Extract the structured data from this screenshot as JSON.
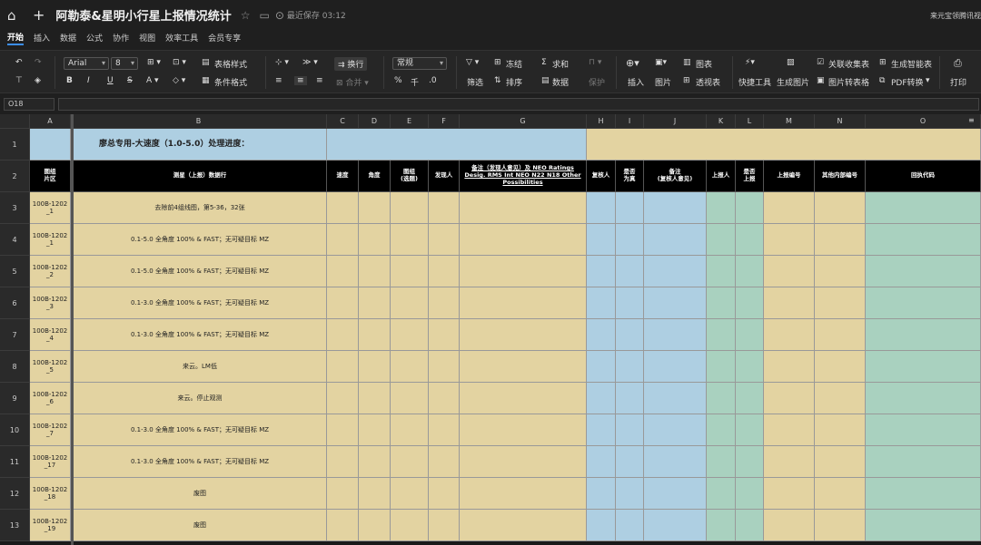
{
  "titlebar": {
    "title": "阿勒泰&星明小行星上报情况统计",
    "saved": "最近保存 03:12",
    "user": "来元宝领腾讯视频"
  },
  "menu": [
    "开始",
    "插入",
    "数据",
    "公式",
    "协作",
    "视图",
    "效率工具",
    "会员专享"
  ],
  "toolbar": {
    "font": "Arial",
    "size": "8",
    "table_style": "表格样式",
    "cond_format": "条件格式",
    "wrap": "换行",
    "merge": "合并",
    "number_format": "常规",
    "filter": "筛选",
    "freeze": "冻结",
    "sort": "排序",
    "sum": "求和",
    "data": "数据",
    "protect": "保护",
    "insert": "插入",
    "image": "图片",
    "chart": "图表",
    "pivot": "透视表",
    "quick_tools": "快捷工具",
    "gen_image": "生成图片",
    "form": "关联收集表",
    "smart_table": "生成智能表",
    "img_to_table": "图片转表格",
    "pdf": "PDF转换",
    "print": "打印",
    "percent": "%",
    "thousand": "千",
    "decimal": ".0"
  },
  "namebox": "O18",
  "columns": [
    "A",
    "B",
    "C",
    "D",
    "E",
    "F",
    "G",
    "H",
    "I",
    "J",
    "K",
    "L",
    "M",
    "N",
    "O"
  ],
  "row1": {
    "title": "廖总专用-大速度（1.0-5.0）处理进度："
  },
  "headers": [
    "图组\n片区",
    "测星（上报）数据行",
    "速度",
    "角度",
    "图组\n(选题)",
    "发现人",
    "备注（发现人意见）及 NEO Ratings Desig. RMS Int NEO N22 N18 Other Possibilities",
    "复核人",
    "是否\n为真",
    "备注\n(复核人意见)",
    "上报人",
    "是否\n上报",
    "上报编号",
    "其他内部编号",
    "回执代码"
  ],
  "rows": [
    {
      "num": "3",
      "a": "100B-1202\n_1",
      "b": "去除前4组线图，第5-36，32张"
    },
    {
      "num": "4",
      "a": "100B-1202\n_1",
      "b": "0.1-5.0 全角度 100% & FAST；无可疑目标 MZ"
    },
    {
      "num": "5",
      "a": "100B-1202\n_2",
      "b": "0.1-5.0 全角度 100% & FAST；无可疑目标 MZ"
    },
    {
      "num": "6",
      "a": "100B-1202\n_3",
      "b": "0.1-3.0 全角度 100% & FAST；无可疑目标 MZ"
    },
    {
      "num": "7",
      "a": "100B-1202\n_4",
      "b": "0.1-3.0 全角度 100% & FAST；无可疑目标 MZ"
    },
    {
      "num": "8",
      "a": "100B-1202\n_5",
      "b": "来云。LM低"
    },
    {
      "num": "9",
      "a": "100B-1202\n_6",
      "b": "来云。停止观测"
    },
    {
      "num": "10",
      "a": "100B-1202\n_7",
      "b": "0.1-3.0 全角度 100% & FAST；无可疑目标 MZ"
    },
    {
      "num": "11",
      "a": "100B-1202\n_17",
      "b": "0.1-3.0 全角度 100% & FAST；无可疑目标 MZ"
    },
    {
      "num": "12",
      "a": "100B-1202\n_18",
      "b": "废图"
    },
    {
      "num": "13",
      "a": "100B-1202\n_19",
      "b": "废图"
    }
  ],
  "colors": {
    "tan": "#e3d3a1",
    "blue": "#aecfe2",
    "green": "#a9d1bf"
  }
}
